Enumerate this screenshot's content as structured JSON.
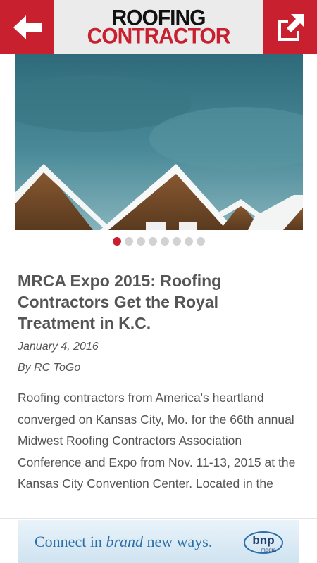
{
  "header": {
    "logo_line1": "ROOFING",
    "logo_line2": "CONTRACTOR",
    "back_icon": "arrow-left-icon",
    "share_icon": "external-link-icon",
    "accent": "#c8202f"
  },
  "carousel": {
    "slide_count": 8,
    "active_index": 0
  },
  "article": {
    "title": "MRCA Expo 2015: Roofing Contractors Get the Royal Treatment in K.C.",
    "date": "January 4, 2016",
    "byline": "By RC ToGo",
    "body": "Roofing contractors from America's heartland converged on Kansas City, Mo. for the 66th annual Midwest Roofing Contractors Association Conference and Expo from Nov. 11-13, 2015 at the Kansas City Convention Center. Located in the"
  },
  "ad": {
    "text_before": "Connect in ",
    "text_emphasis": "brand",
    "text_after": " new ways.",
    "brand": "bnp",
    "brand_sub": "media"
  }
}
